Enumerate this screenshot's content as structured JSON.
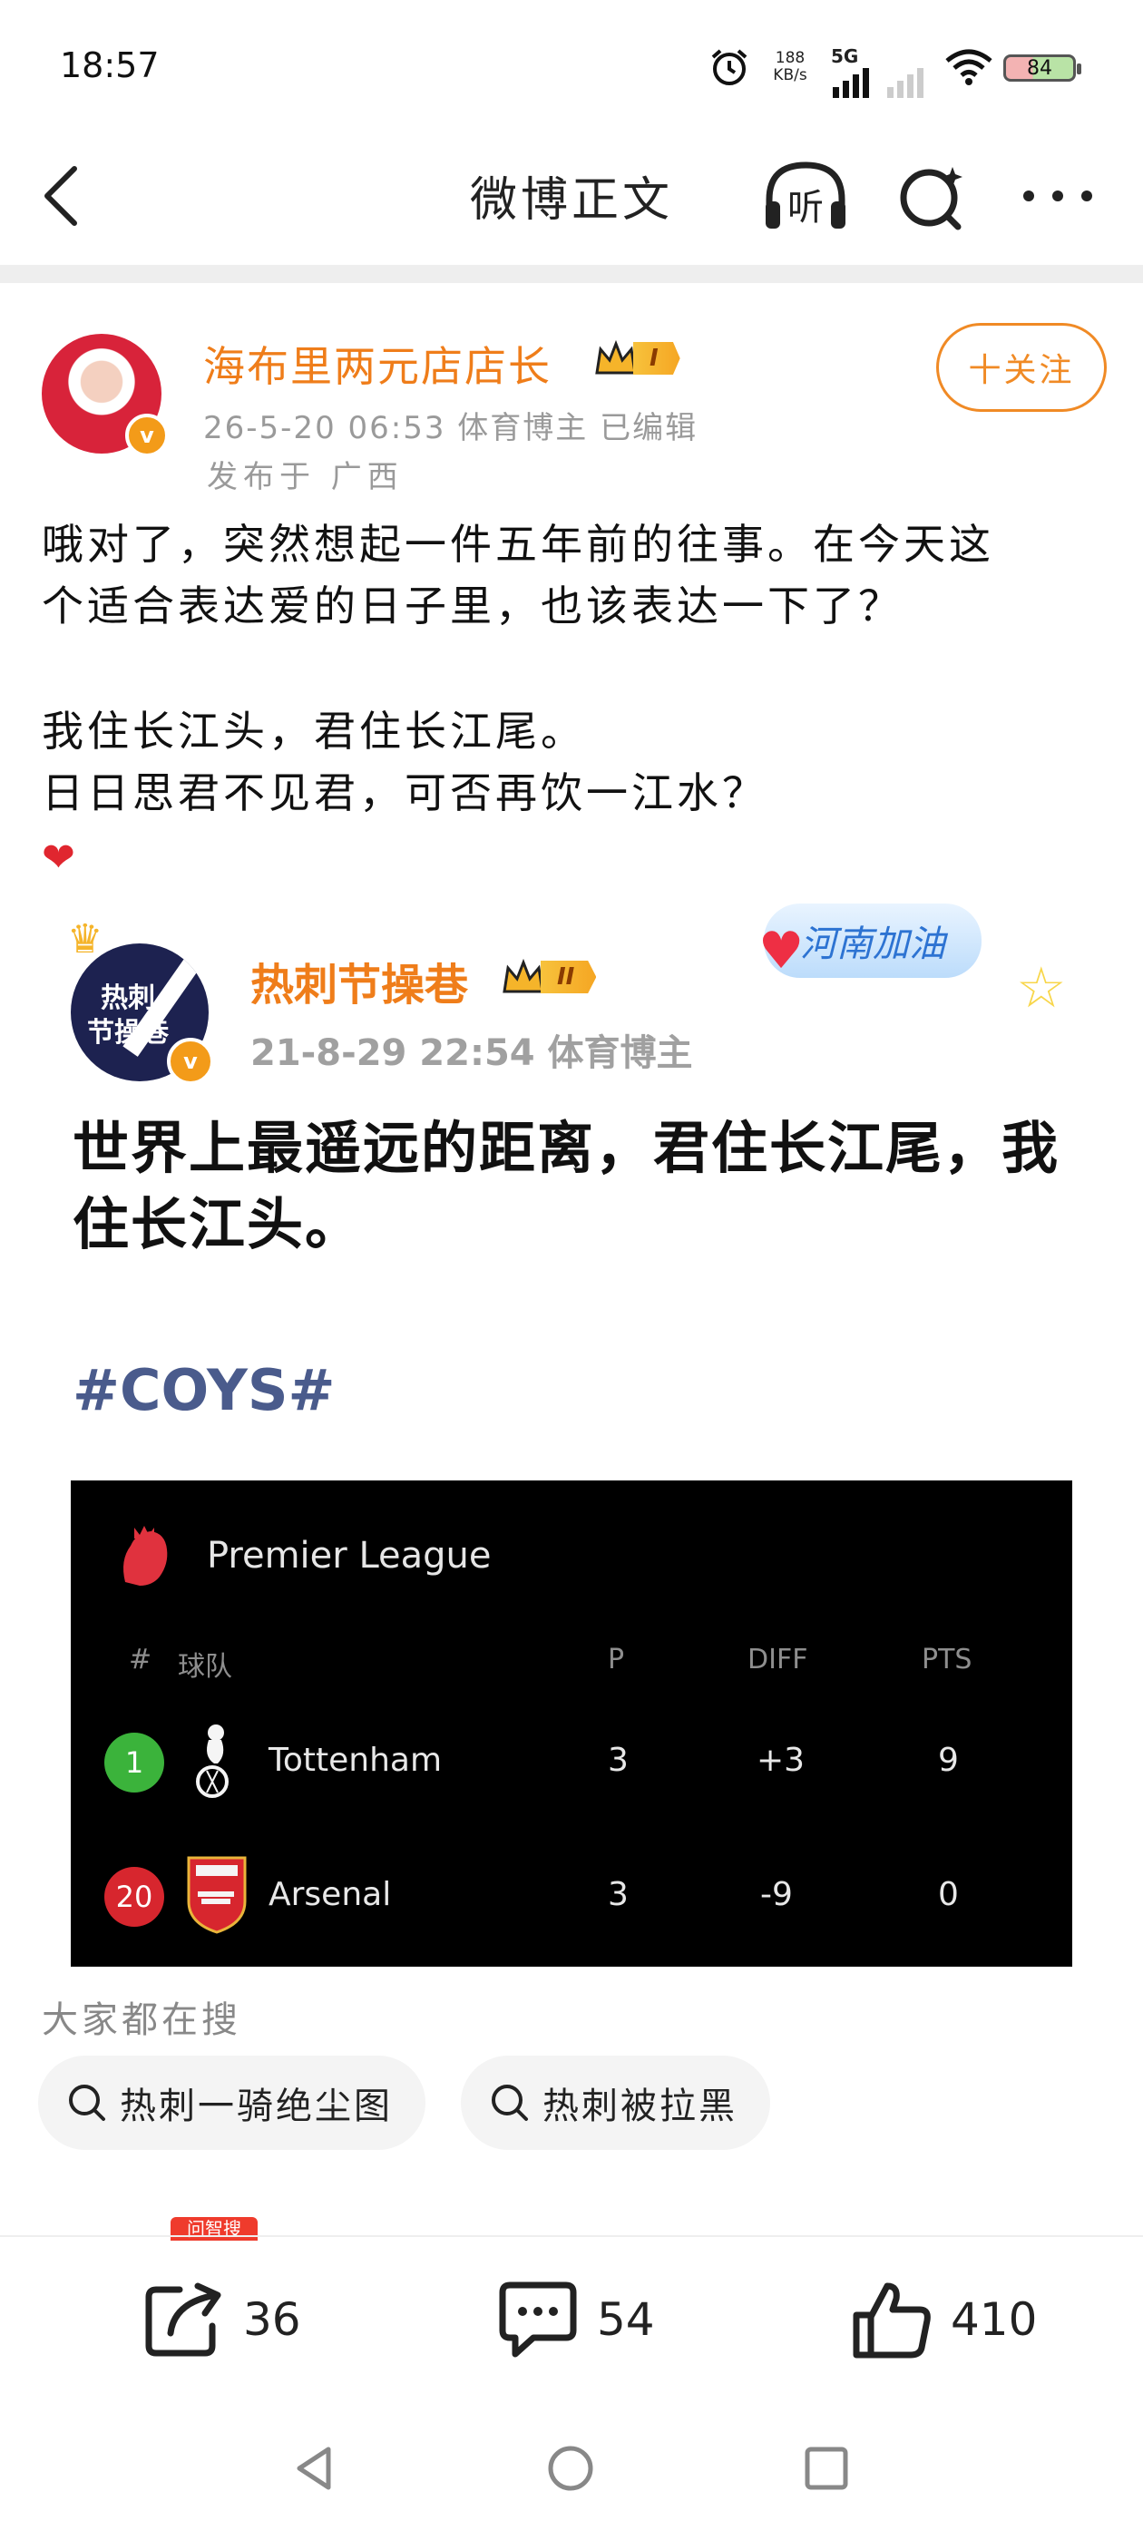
{
  "status_bar": {
    "time": "18:57",
    "net_speed_value": "188",
    "net_speed_unit": "KB/s",
    "network": "5G",
    "battery": "84",
    "icons": [
      "alarm-icon",
      "signal-icon",
      "wifi-icon",
      "battery-icon"
    ]
  },
  "nav": {
    "title": "微博正文",
    "back_icon": "chevron-left-icon",
    "listen_label": "听",
    "search_icon": "search-sparkle-icon",
    "more_icon": "more-dots-icon"
  },
  "post": {
    "author": "海布里两元店店长",
    "level_badge": "I",
    "meta": "26-5-20 06:53   体育博主   已编辑",
    "location": "发布于 广西",
    "follow_label": "十关注",
    "text_line1": "哦对了，突然想起一件五年前的往事。在今天这",
    "text_line2": "个适合表达爱的日子里，也该表达一下了？",
    "text_line3": "我住长江头，君住长江尾。",
    "text_line4": "日日思君不见君，可否再饮一江水？",
    "emoji": "❤"
  },
  "embedded": {
    "avatar_text_line1": "热刺",
    "avatar_text_line2": "节操巷",
    "author": "热刺节操巷",
    "level_badge": "II",
    "meta": "21-8-29 22:54  体育博主",
    "stamp": "河南加油",
    "text_line1": "世界上最遥远的距离，君住长江尾，我",
    "text_line2": "住长江头。",
    "hashtag": "#COYS#"
  },
  "league_table": {
    "title": "Premier League",
    "headers": {
      "rank": "#",
      "team": "球队",
      "played": "P",
      "diff": "DIFF",
      "points": "PTS"
    },
    "rows": [
      {
        "rank": "1",
        "team": "Tottenham",
        "played": "3",
        "diff": "+3",
        "points": "9",
        "rank_color": "#3bb33b"
      },
      {
        "rank": "20",
        "team": "Arsenal",
        "played": "3",
        "diff": "-9",
        "points": "0",
        "rank_color": "#d7262e"
      }
    ]
  },
  "search": {
    "label": "大家都在搜",
    "chips": [
      "热刺一骑绝尘图",
      "热刺被拉黑"
    ],
    "peek_label": "问智搜"
  },
  "actions": {
    "repost_count": "36",
    "comment_count": "54",
    "like_count": "410"
  },
  "colors": {
    "accent_orange": "#ef7d1a",
    "hashtag_blue": "#4a5b8c"
  }
}
